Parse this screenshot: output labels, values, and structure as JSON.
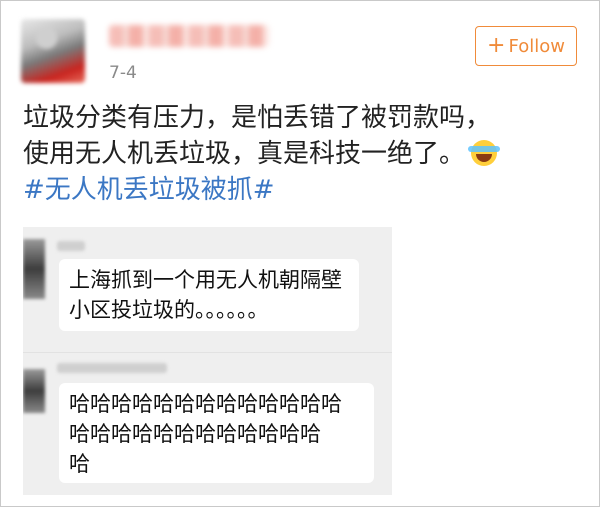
{
  "header": {
    "date": "7-4",
    "follow_label": "Follow",
    "follow_plus": "+"
  },
  "post": {
    "lines": [
      "垃圾分类有压力，是怕丢错了被罚款吗，",
      "使用无人机丢垃圾，真是科技一绝了。"
    ],
    "hashtag": "#无人机丢垃圾被抓#"
  },
  "embedded": {
    "comment1": [
      "上海抓到一个用无人机朝隔壁",
      "小区投垃圾的。。。。。。"
    ],
    "comment2": [
      "哈哈哈哈哈哈哈哈哈哈哈哈哈",
      "哈哈哈哈哈哈哈哈哈哈哈哈",
      "哈"
    ]
  },
  "colors": {
    "accent": "#f08b3a",
    "hashtag": "#3b77c4"
  }
}
